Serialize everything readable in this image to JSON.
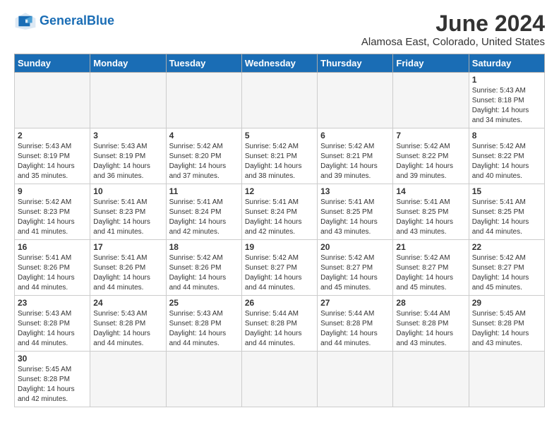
{
  "header": {
    "logo_general": "General",
    "logo_blue": "Blue",
    "month_title": "June 2024",
    "subtitle": "Alamosa East, Colorado, United States"
  },
  "weekdays": [
    "Sunday",
    "Monday",
    "Tuesday",
    "Wednesday",
    "Thursday",
    "Friday",
    "Saturday"
  ],
  "weeks": [
    [
      {
        "day": "",
        "info": ""
      },
      {
        "day": "",
        "info": ""
      },
      {
        "day": "",
        "info": ""
      },
      {
        "day": "",
        "info": ""
      },
      {
        "day": "",
        "info": ""
      },
      {
        "day": "",
        "info": ""
      },
      {
        "day": "1",
        "info": "Sunrise: 5:43 AM\nSunset: 8:18 PM\nDaylight: 14 hours\nand 34 minutes."
      }
    ],
    [
      {
        "day": "2",
        "info": "Sunrise: 5:43 AM\nSunset: 8:19 PM\nDaylight: 14 hours\nand 35 minutes."
      },
      {
        "day": "3",
        "info": "Sunrise: 5:43 AM\nSunset: 8:19 PM\nDaylight: 14 hours\nand 36 minutes."
      },
      {
        "day": "4",
        "info": "Sunrise: 5:42 AM\nSunset: 8:20 PM\nDaylight: 14 hours\nand 37 minutes."
      },
      {
        "day": "5",
        "info": "Sunrise: 5:42 AM\nSunset: 8:21 PM\nDaylight: 14 hours\nand 38 minutes."
      },
      {
        "day": "6",
        "info": "Sunrise: 5:42 AM\nSunset: 8:21 PM\nDaylight: 14 hours\nand 39 minutes."
      },
      {
        "day": "7",
        "info": "Sunrise: 5:42 AM\nSunset: 8:22 PM\nDaylight: 14 hours\nand 39 minutes."
      },
      {
        "day": "8",
        "info": "Sunrise: 5:42 AM\nSunset: 8:22 PM\nDaylight: 14 hours\nand 40 minutes."
      }
    ],
    [
      {
        "day": "9",
        "info": "Sunrise: 5:42 AM\nSunset: 8:23 PM\nDaylight: 14 hours\nand 41 minutes."
      },
      {
        "day": "10",
        "info": "Sunrise: 5:41 AM\nSunset: 8:23 PM\nDaylight: 14 hours\nand 41 minutes."
      },
      {
        "day": "11",
        "info": "Sunrise: 5:41 AM\nSunset: 8:24 PM\nDaylight: 14 hours\nand 42 minutes."
      },
      {
        "day": "12",
        "info": "Sunrise: 5:41 AM\nSunset: 8:24 PM\nDaylight: 14 hours\nand 42 minutes."
      },
      {
        "day": "13",
        "info": "Sunrise: 5:41 AM\nSunset: 8:25 PM\nDaylight: 14 hours\nand 43 minutes."
      },
      {
        "day": "14",
        "info": "Sunrise: 5:41 AM\nSunset: 8:25 PM\nDaylight: 14 hours\nand 43 minutes."
      },
      {
        "day": "15",
        "info": "Sunrise: 5:41 AM\nSunset: 8:25 PM\nDaylight: 14 hours\nand 44 minutes."
      }
    ],
    [
      {
        "day": "16",
        "info": "Sunrise: 5:41 AM\nSunset: 8:26 PM\nDaylight: 14 hours\nand 44 minutes."
      },
      {
        "day": "17",
        "info": "Sunrise: 5:41 AM\nSunset: 8:26 PM\nDaylight: 14 hours\nand 44 minutes."
      },
      {
        "day": "18",
        "info": "Sunrise: 5:42 AM\nSunset: 8:26 PM\nDaylight: 14 hours\nand 44 minutes."
      },
      {
        "day": "19",
        "info": "Sunrise: 5:42 AM\nSunset: 8:27 PM\nDaylight: 14 hours\nand 44 minutes."
      },
      {
        "day": "20",
        "info": "Sunrise: 5:42 AM\nSunset: 8:27 PM\nDaylight: 14 hours\nand 45 minutes."
      },
      {
        "day": "21",
        "info": "Sunrise: 5:42 AM\nSunset: 8:27 PM\nDaylight: 14 hours\nand 45 minutes."
      },
      {
        "day": "22",
        "info": "Sunrise: 5:42 AM\nSunset: 8:27 PM\nDaylight: 14 hours\nand 45 minutes."
      }
    ],
    [
      {
        "day": "23",
        "info": "Sunrise: 5:43 AM\nSunset: 8:28 PM\nDaylight: 14 hours\nand 44 minutes."
      },
      {
        "day": "24",
        "info": "Sunrise: 5:43 AM\nSunset: 8:28 PM\nDaylight: 14 hours\nand 44 minutes."
      },
      {
        "day": "25",
        "info": "Sunrise: 5:43 AM\nSunset: 8:28 PM\nDaylight: 14 hours\nand 44 minutes."
      },
      {
        "day": "26",
        "info": "Sunrise: 5:44 AM\nSunset: 8:28 PM\nDaylight: 14 hours\nand 44 minutes."
      },
      {
        "day": "27",
        "info": "Sunrise: 5:44 AM\nSunset: 8:28 PM\nDaylight: 14 hours\nand 44 minutes."
      },
      {
        "day": "28",
        "info": "Sunrise: 5:44 AM\nSunset: 8:28 PM\nDaylight: 14 hours\nand 43 minutes."
      },
      {
        "day": "29",
        "info": "Sunrise: 5:45 AM\nSunset: 8:28 PM\nDaylight: 14 hours\nand 43 minutes."
      }
    ],
    [
      {
        "day": "30",
        "info": "Sunrise: 5:45 AM\nSunset: 8:28 PM\nDaylight: 14 hours\nand 42 minutes."
      },
      {
        "day": "",
        "info": ""
      },
      {
        "day": "",
        "info": ""
      },
      {
        "day": "",
        "info": ""
      },
      {
        "day": "",
        "info": ""
      },
      {
        "day": "",
        "info": ""
      },
      {
        "day": "",
        "info": ""
      }
    ]
  ]
}
